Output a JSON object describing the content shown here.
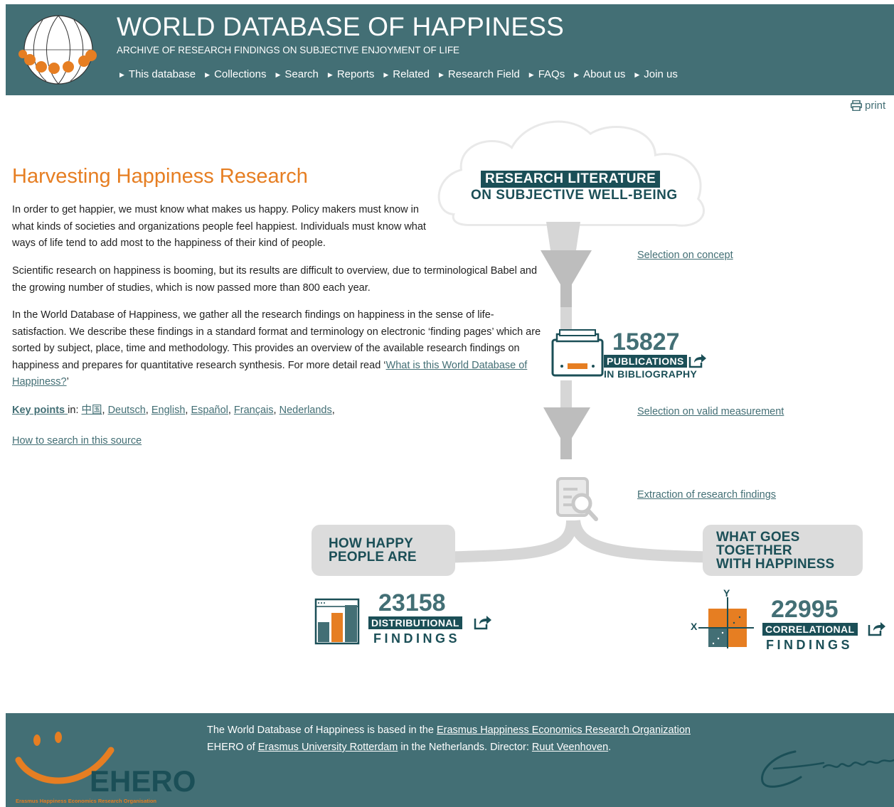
{
  "header": {
    "title": "WORLD DATABASE OF HAPPINESS",
    "subtitle": "ARCHIVE OF RESEARCH FINDINGS ON SUBJECTIVE ENJOYMENT OF LIFE",
    "nav": [
      "This database",
      "Collections",
      "Search",
      "Reports",
      "Related",
      "Research Field",
      "FAQs",
      "About us",
      "Join us"
    ]
  },
  "print_label": "print",
  "main": {
    "title": "Harvesting Happiness Research",
    "p1": "In order to get happier, we must know what makes us happy. Policy makers must know in what kinds of societies and organizations people feel happiest. Individuals must know what ways of life tend to add most to the happiness of their kind of people.",
    "p2": "Scientific research on happiness is booming, but its results are difficult to overview, due to terminological Babel and the growing number of studies, which is now passed more than 800 each year.",
    "p3": "In the World Database of Happiness, we gather all the research findings on happiness in the sense of life-satisfaction. We describe these findings in a standard format and terminology on electronic ‘finding pages’ which are sorted by subject, place, time and methodology.  This provides an overview of the available research findings on happiness and prepares for quantitative research synthesis. For more detail read ",
    "p3_link": "What is this World Database of Happiness?",
    "p3_open_quote": "‘",
    "p3_close_quote": "’",
    "keypoints_title": "Key points ",
    "keypoints_in": "in: ",
    "keypoints_langs": [
      "中国",
      "Deutsch",
      "English",
      "Español",
      "Français",
      "Nederlands"
    ],
    "howto_link": "How to search in this source"
  },
  "infographic": {
    "cloud_line1": "RESEARCH LITERATURE",
    "cloud_line2": "ON SUBJECTIVE WELL-BEING",
    "step1": "Selection on concept",
    "publications_count": "15827",
    "publications_tag": "PUBLICATIONS",
    "publications_sub": "IN  BIBLIOGRAPHY",
    "step2": "Selection on valid measurement",
    "step3": "Extraction of research findings",
    "left_box": "HOW HAPPY\nPEOPLE ARE",
    "right_box": "WHAT GOES\nTOGETHER\nWITH HAPPINESS",
    "distributional_count": "23158",
    "distributional_tag": "DISTRIBUTIONAL",
    "distributional_sub": "FINDINGS",
    "correlational_count": "22995",
    "correlational_tag": "CORRELATIONAL",
    "correlational_sub": "FINDINGS",
    "axis_y": "Y",
    "axis_x": "X"
  },
  "footer": {
    "line1_pre": "The World Database of Happiness is based in the ",
    "line1_link": "Erasmus Happiness Economics Research Organization",
    "line2_pre": "EHERO of ",
    "line2_link1": "Erasmus University Rotterdam",
    "line2_mid": " in the Netherlands. Director: ",
    "line2_link2": "Ruut Veenhoven",
    "line2_end": ".",
    "ehero_logo": "EHERO",
    "ehero_caption": "Erasmus Happiness Economics Research Organisation"
  },
  "colors": {
    "header_bg": "#436f75",
    "accent_orange": "#e67e22",
    "dark_teal": "#1b4f57",
    "funnel_grey": "#c8c8c8"
  }
}
